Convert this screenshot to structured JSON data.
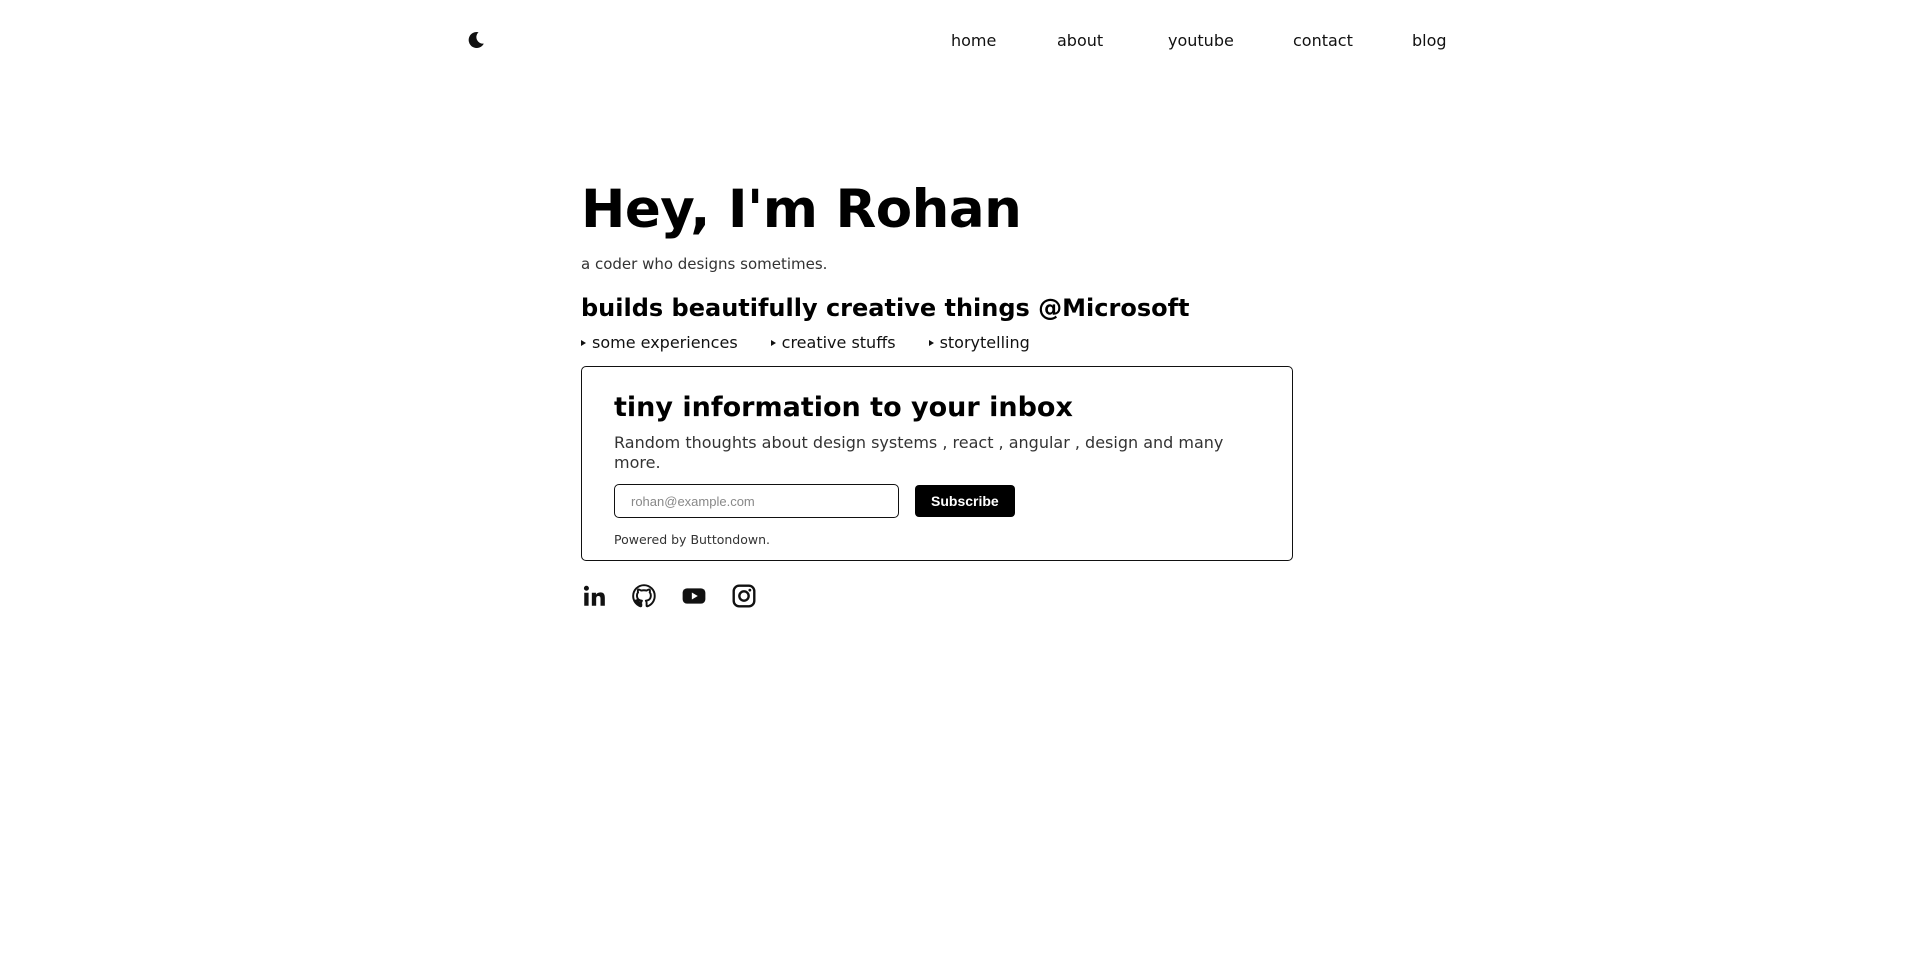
{
  "header": {
    "theme_icon": "moon-icon",
    "nav": [
      {
        "label": "home"
      },
      {
        "label": "about"
      },
      {
        "label": "youtube"
      },
      {
        "label": "contact"
      },
      {
        "label": "blog"
      }
    ]
  },
  "hero": {
    "title": "Hey, I'm Rohan",
    "tagline": "a coder who designs sometimes.",
    "subhead": "builds beautifully creative things @Microsoft",
    "links": [
      {
        "label": "some experiences"
      },
      {
        "label": "creative stuffs"
      },
      {
        "label": "storytelling"
      }
    ]
  },
  "newsletter": {
    "title": "tiny information to your inbox",
    "description": "Random thoughts about design systems , react , angular , design and many more.",
    "email_placeholder": "rohan@example.com",
    "email_value": "",
    "subscribe_label": "Subscribe",
    "powered_prefix": "Powered by ",
    "powered_link": "Buttondown",
    "powered_suffix": "."
  },
  "socials": [
    {
      "icon": "linkedin-icon"
    },
    {
      "icon": "github-icon"
    },
    {
      "icon": "youtube-icon"
    },
    {
      "icon": "instagram-icon"
    }
  ],
  "colors": {
    "background": "#ffffff",
    "text": "#000000",
    "button_bg": "#000000",
    "button_text": "#ffffff"
  }
}
